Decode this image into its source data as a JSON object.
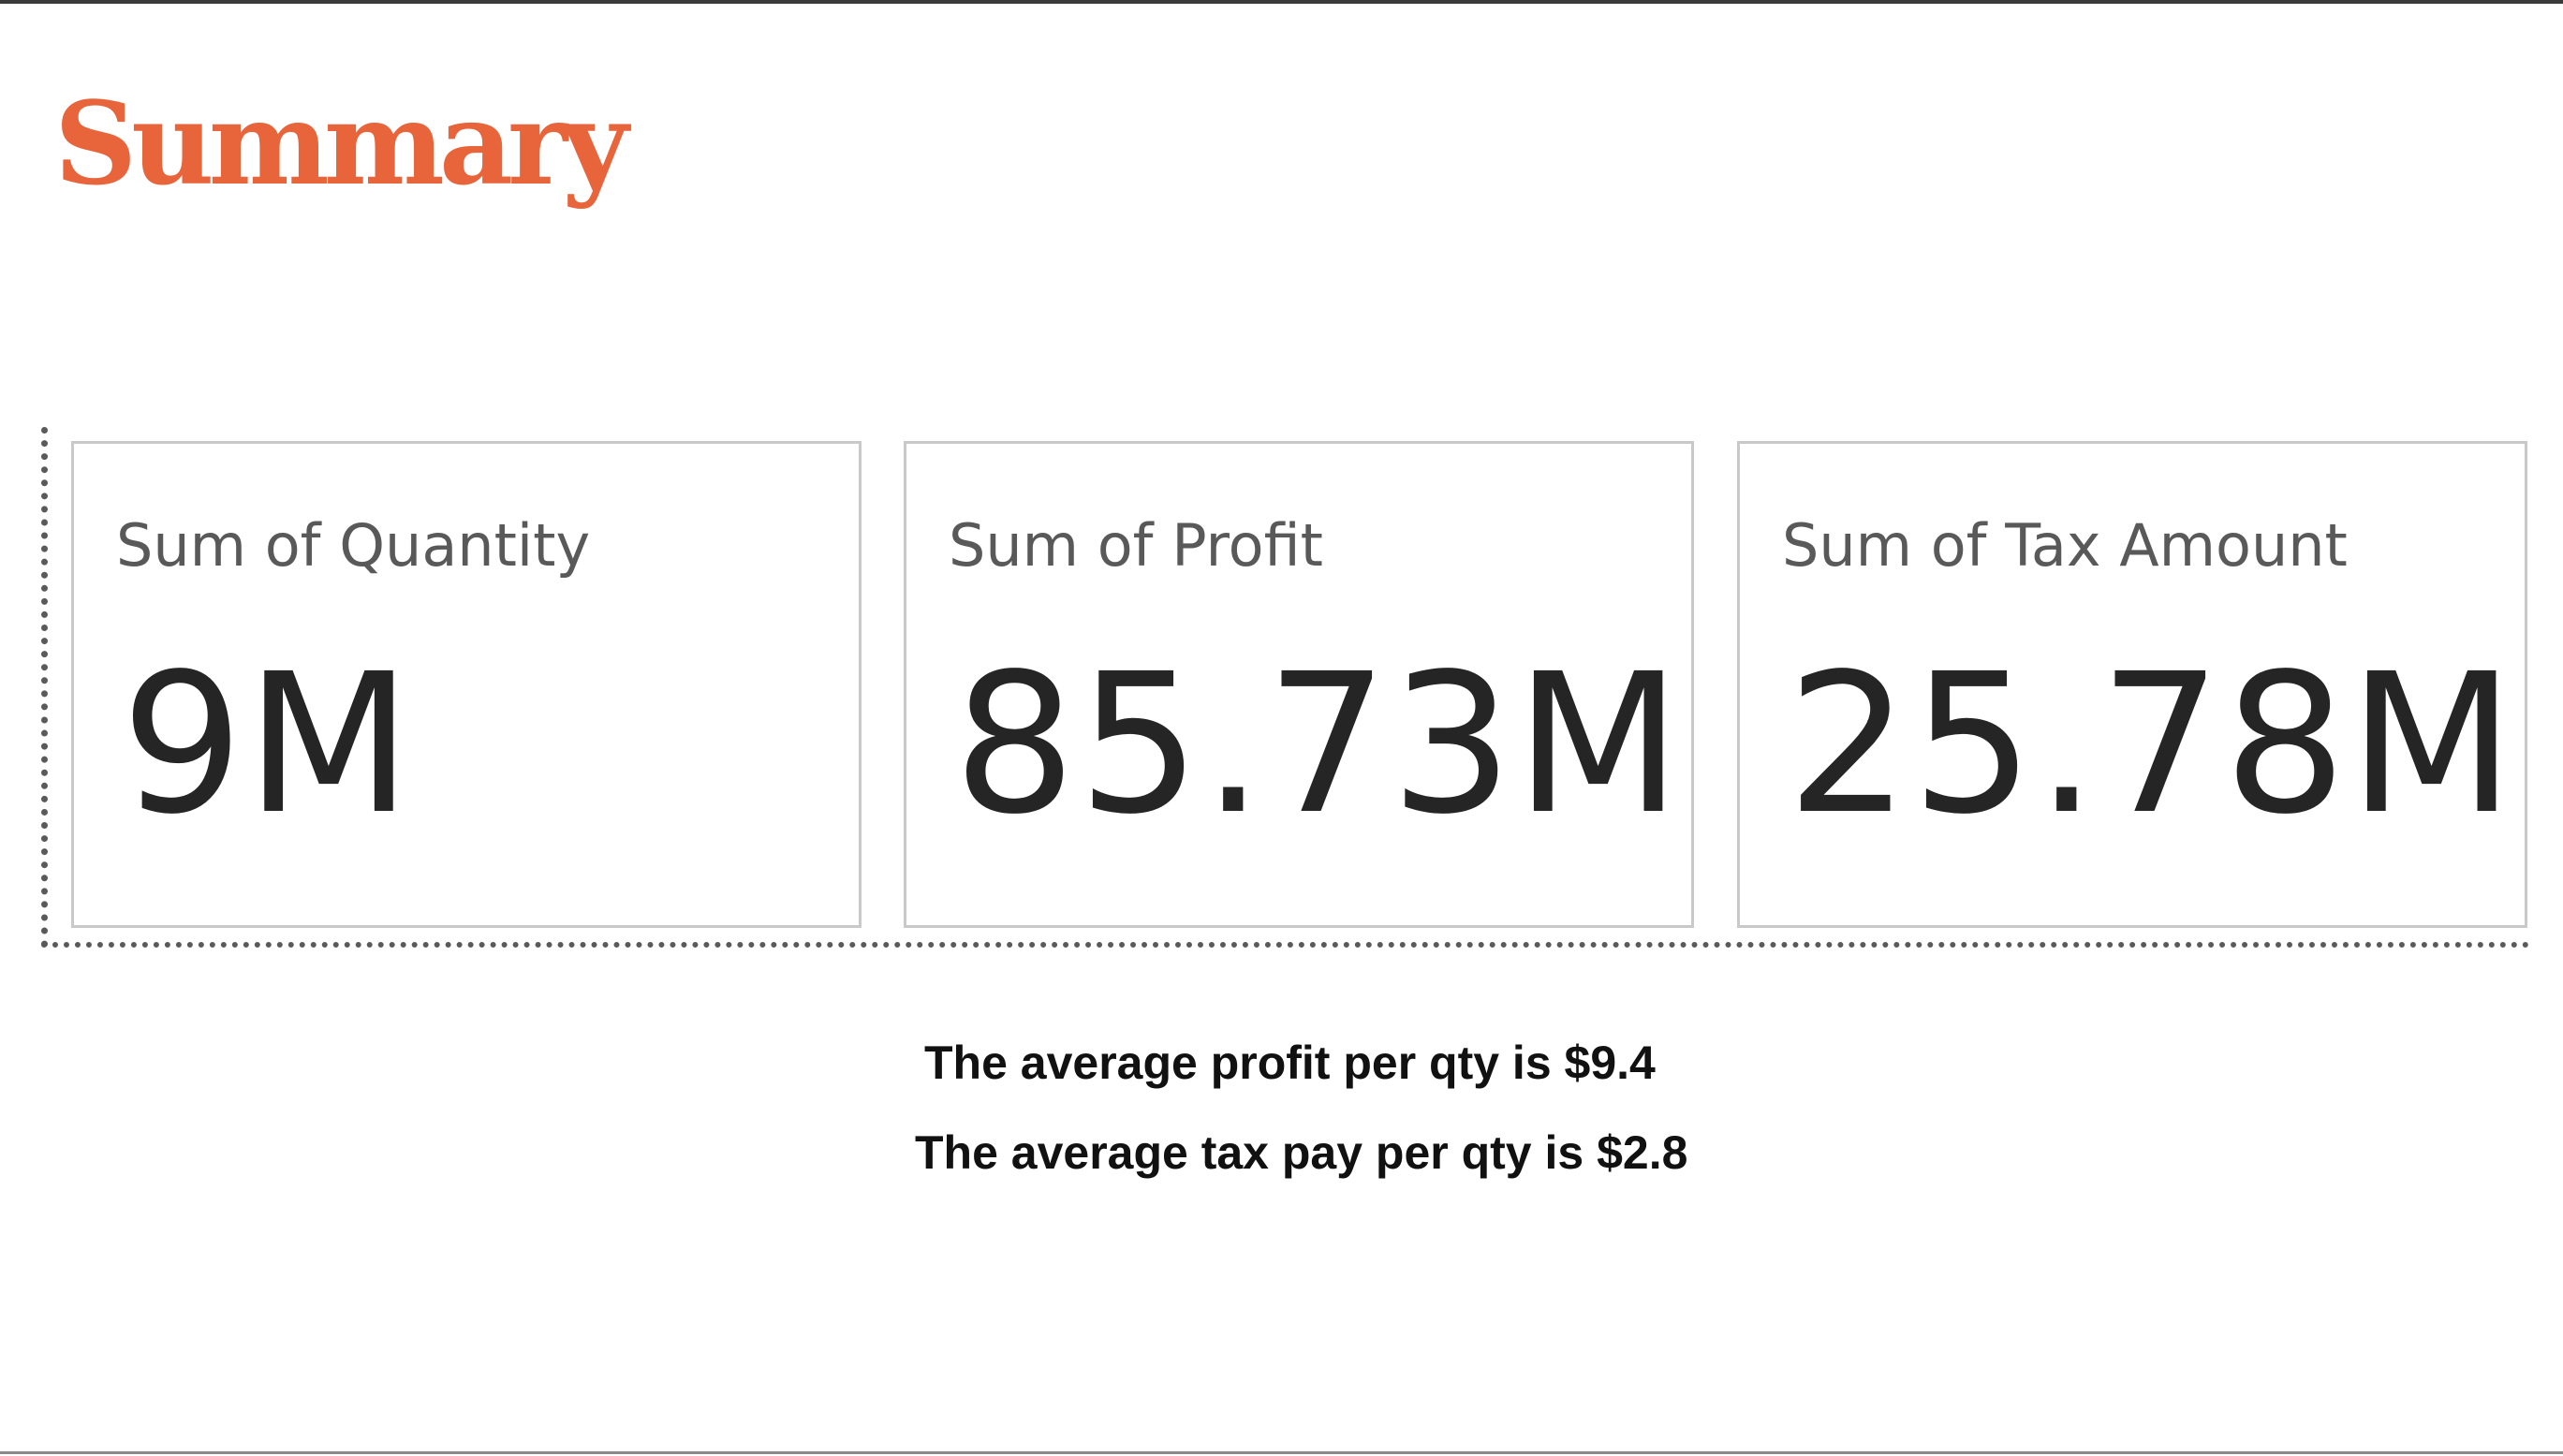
{
  "page": {
    "title": "Summary",
    "accent_color": "#E8643A"
  },
  "cards": [
    {
      "label": "Sum of Quantity",
      "value": "9M"
    },
    {
      "label": "Sum of Profit",
      "value": "85.73M"
    },
    {
      "label": "Sum of Tax Amount",
      "value": "25.78M"
    }
  ],
  "notes": {
    "profit": "The average profit per qty is $9.4",
    "tax": "The average tax pay per qty is $2.8"
  }
}
